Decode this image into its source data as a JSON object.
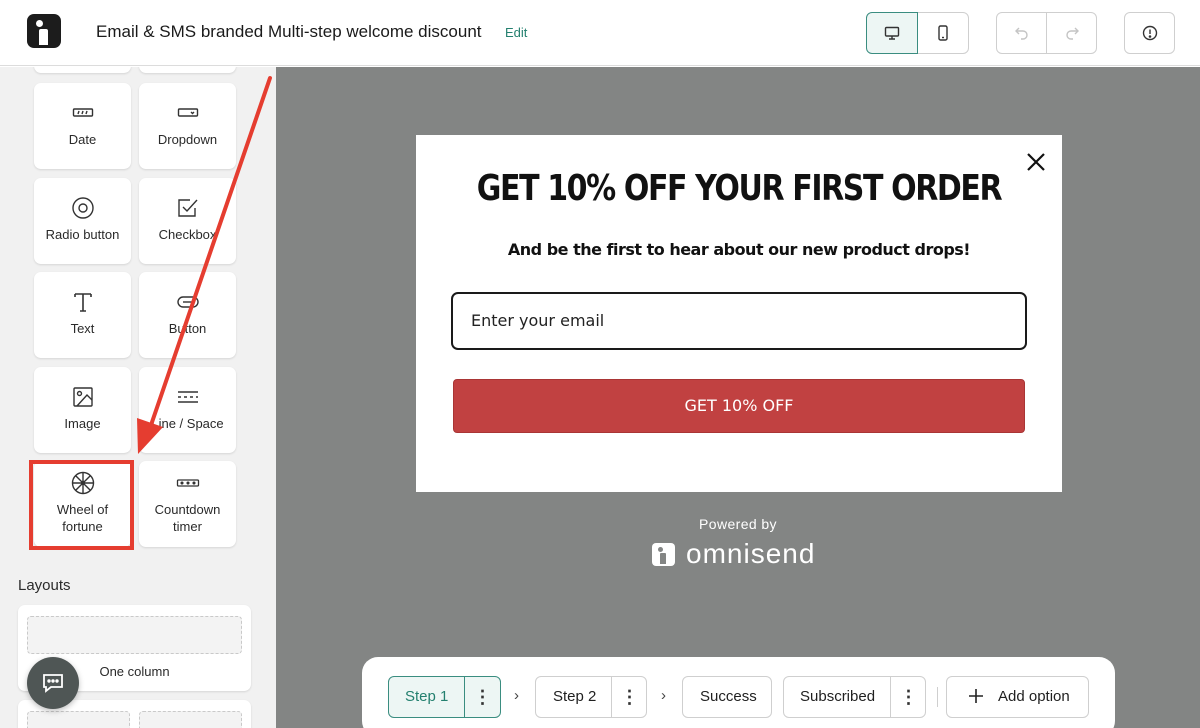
{
  "header": {
    "title": "Email & SMS branded Multi-step welcome discount",
    "edit_label": "Edit"
  },
  "sidebar": {
    "tiles": [
      {
        "label": "Date",
        "icon": "date-field-icon"
      },
      {
        "label": "Dropdown",
        "icon": "dropdown-field-icon"
      },
      {
        "label": "Radio button",
        "icon": "radio-button-icon"
      },
      {
        "label": "Checkbox",
        "icon": "checkbox-icon"
      },
      {
        "label": "Text",
        "icon": "text-icon"
      },
      {
        "label": "Button",
        "icon": "button-icon"
      },
      {
        "label": "Image",
        "icon": "image-icon"
      },
      {
        "label": "Line / Space",
        "icon": "line-space-icon"
      },
      {
        "label": "Wheel of fortune",
        "icon": "wheel-of-fortune-icon"
      },
      {
        "label": "Countdown timer",
        "icon": "countdown-timer-icon"
      }
    ],
    "layouts_title": "Layouts",
    "layouts": [
      {
        "label": "One column"
      }
    ]
  },
  "popup": {
    "headline": "GET 10% OFF YOUR FIRST ORDER",
    "subheadline": "And be the first to hear about our new product drops!",
    "email_placeholder": "Enter your email",
    "cta_label": "GET 10% OFF",
    "cta_color": "#c14141"
  },
  "branding": {
    "powered_by": "Powered by",
    "brand_name": "omnisend"
  },
  "steps": {
    "items": [
      {
        "label": "Step 1",
        "active": true
      },
      {
        "label": "Step 2",
        "active": false
      },
      {
        "label": "Success",
        "active": false
      },
      {
        "label": "Subscribed",
        "active": false
      }
    ],
    "add_option_label": "Add option"
  },
  "colors": {
    "accent": "#24806f",
    "canvas_bg": "#838584",
    "annotation_red": "#e53d30"
  }
}
